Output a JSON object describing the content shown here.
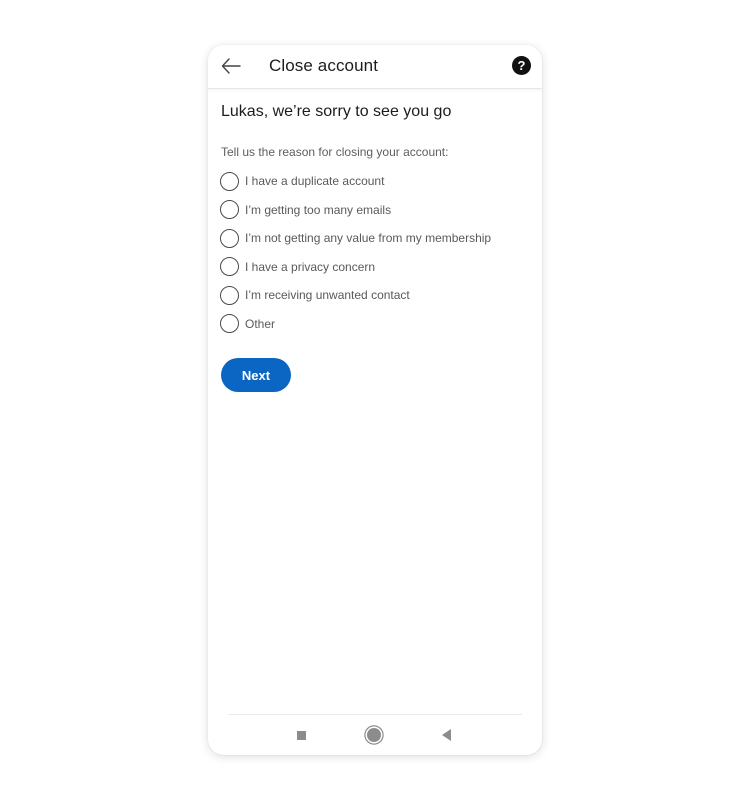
{
  "header": {
    "title": "Close account",
    "back_icon": "arrow-left-icon",
    "help_icon": "help-circle-icon",
    "help_glyph": "?"
  },
  "main": {
    "heading": "Lukas, we’re sorry to see you go",
    "prompt": "Tell us the reason for closing your account:",
    "options": [
      {
        "label": "I have a duplicate account",
        "selected": false
      },
      {
        "label": "I’m getting too many emails",
        "selected": false
      },
      {
        "label": "I’m not getting any value from my membership",
        "selected": false
      },
      {
        "label": "I have a privacy concern",
        "selected": false
      },
      {
        "label": "I’m receiving unwanted contact",
        "selected": false
      },
      {
        "label": "Other",
        "selected": false
      }
    ],
    "next_label": "Next"
  },
  "navbar": {
    "icons": [
      "recent-apps-icon",
      "home-icon",
      "back-triangle-icon"
    ]
  },
  "colors": {
    "accent": "#0a66c2",
    "text_primary": "#1c1c1c",
    "text_secondary": "#5a5a5a"
  }
}
